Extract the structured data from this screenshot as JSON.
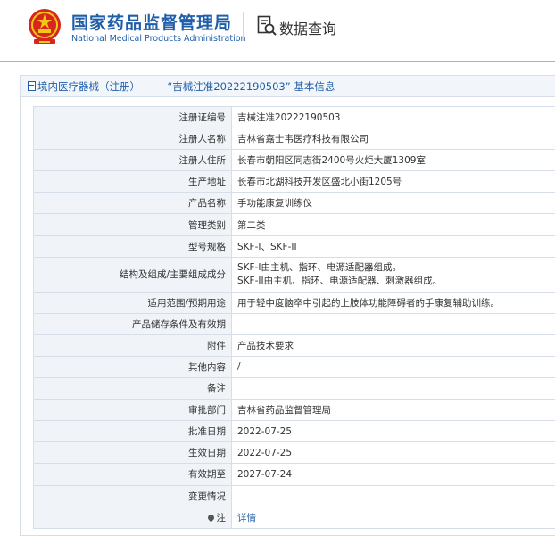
{
  "header": {
    "brand_cn": "国家药品监督管理局",
    "brand_en": "National Medical Products Administration",
    "query_label": "数据查询",
    "brand_color": "#1f5ea8"
  },
  "card": {
    "title_prefix": "境内医疗器械（注册）",
    "title_sep": " —— ",
    "title_main": "“吉械注准20222190503” 基本信息"
  },
  "rows": [
    {
      "label": "注册证编号",
      "value": "吉械注准20222190503"
    },
    {
      "label": "注册人名称",
      "value": "吉林省嘉士韦医疗科技有限公司"
    },
    {
      "label": "注册人住所",
      "value": "长春市朝阳区同志街2400号火炬大厦1309室"
    },
    {
      "label": "生产地址",
      "value": "长春市北湖科技开发区盛北小街1205号"
    },
    {
      "label": "产品名称",
      "value": "手功能康复训练仪"
    },
    {
      "label": "管理类别",
      "value": "第二类"
    },
    {
      "label": "型号规格",
      "value": "SKF-I、SKF-II"
    },
    {
      "label": "结构及组成/主要组成成分",
      "value": "SKF-I由主机、指环、电源适配器组成。",
      "value2": "SKF-II由主机、指环、电源适配器、刺激器组成。"
    },
    {
      "label": "适用范围/预期用途",
      "value": "用于轻中度脑卒中引起的上肢体功能障碍者的手康复辅助训练。"
    },
    {
      "label": "产品储存条件及有效期",
      "value": ""
    },
    {
      "label": "附件",
      "value": "产品技术要求"
    },
    {
      "label": "其他内容",
      "value": "/"
    },
    {
      "label": "备注",
      "value": ""
    },
    {
      "label": "审批部门",
      "value": "吉林省药品监督管理局"
    },
    {
      "label": "批准日期",
      "value": "2022-07-25"
    },
    {
      "label": "生效日期",
      "value": "2022-07-25"
    },
    {
      "label": "有效期至",
      "value": "2027-07-24"
    },
    {
      "label": "变更情况",
      "value": ""
    },
    {
      "label": "注",
      "value": "详情"
    }
  ]
}
